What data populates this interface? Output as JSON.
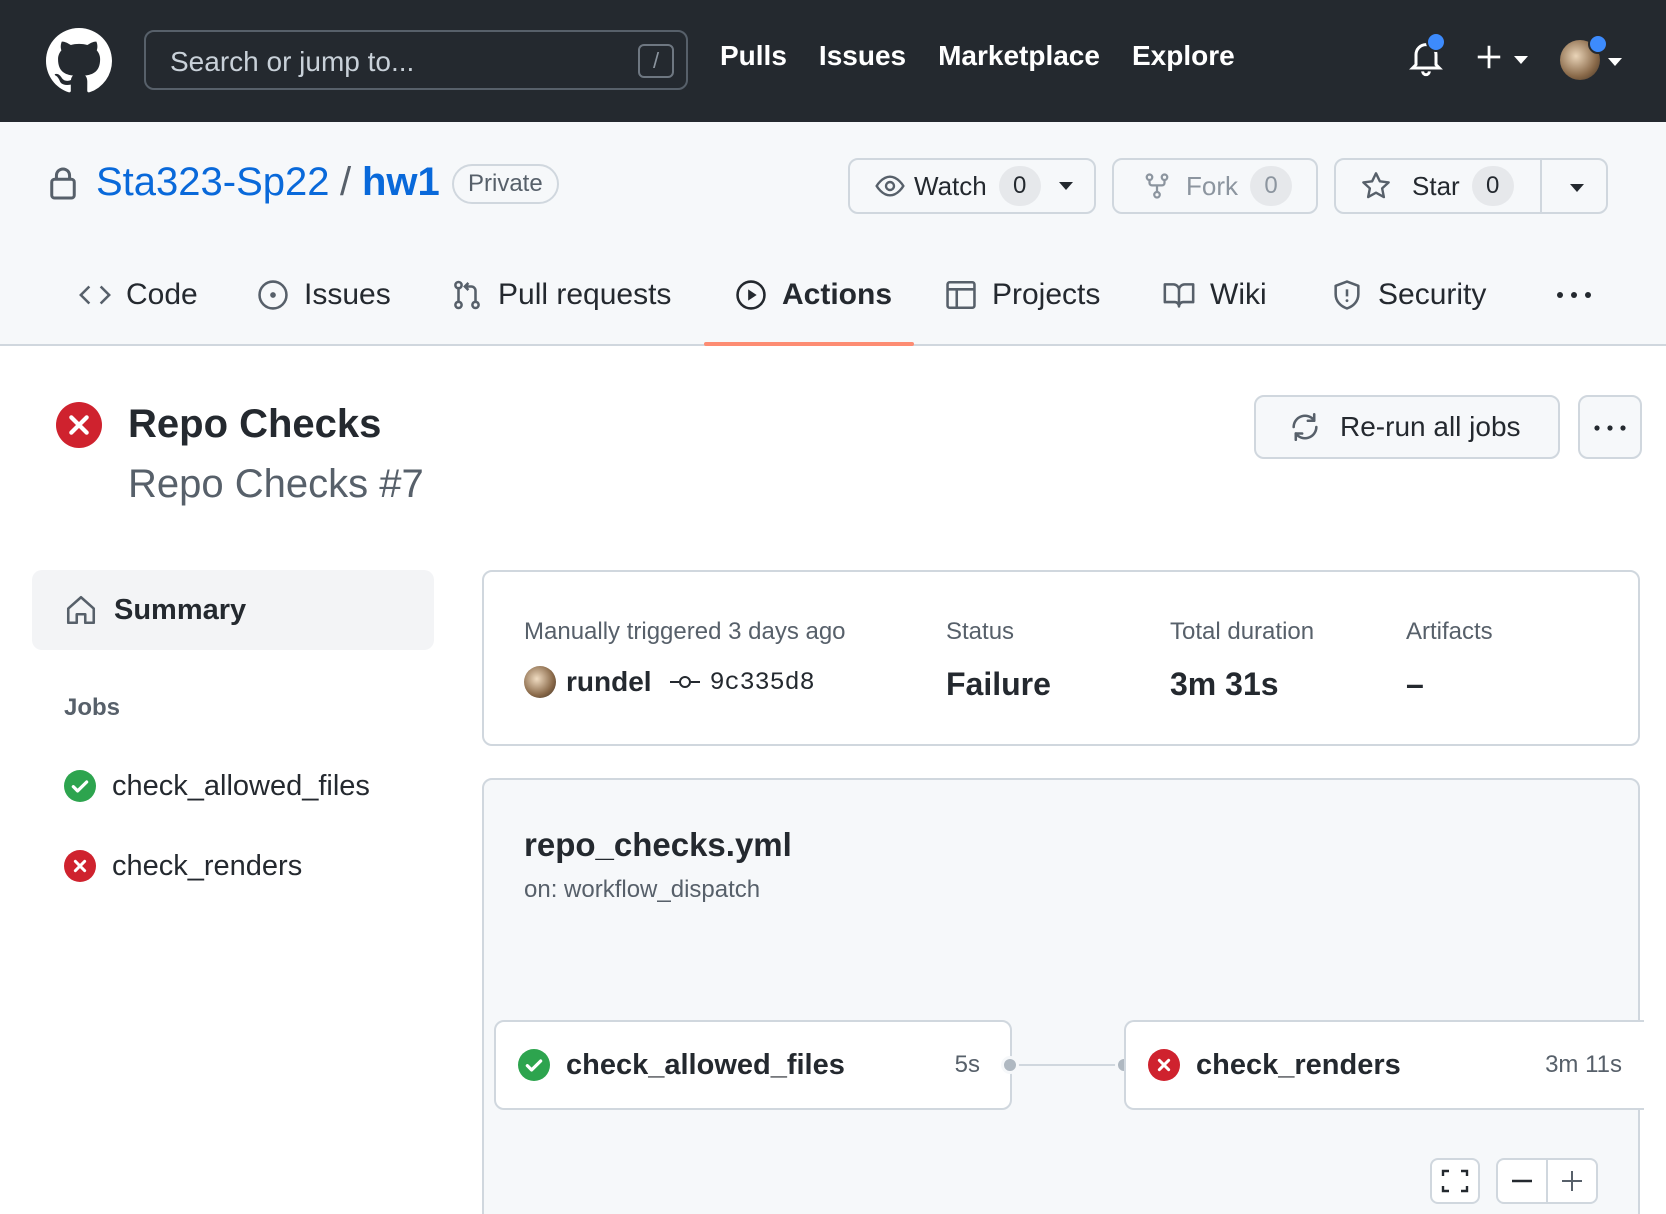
{
  "header": {
    "search_placeholder": "Search or jump to...",
    "search_shortcut": "/",
    "nav": [
      "Pulls",
      "Issues",
      "Marketplace",
      "Explore"
    ]
  },
  "repo": {
    "owner": "Sta323-Sp22",
    "separator": "/",
    "name": "hw1",
    "visibility": "Private",
    "watch": {
      "label": "Watch",
      "count": "0"
    },
    "fork": {
      "label": "Fork",
      "count": "0"
    },
    "star": {
      "label": "Star",
      "count": "0"
    }
  },
  "tabs": [
    {
      "label": "Code",
      "icon": "code-icon"
    },
    {
      "label": "Issues",
      "icon": "issue-opened-icon"
    },
    {
      "label": "Pull requests",
      "icon": "git-pull-request-icon"
    },
    {
      "label": "Actions",
      "icon": "play-icon",
      "active": true
    },
    {
      "label": "Projects",
      "icon": "table-icon"
    },
    {
      "label": "Wiki",
      "icon": "book-icon"
    },
    {
      "label": "Security",
      "icon": "shield-icon"
    }
  ],
  "run": {
    "title": "Repo Checks",
    "subtitle": "Repo Checks #7",
    "status": "failure",
    "rerun_label": "Re-run all jobs"
  },
  "sidebar": {
    "summary_label": "Summary",
    "jobs_heading": "Jobs",
    "jobs": [
      {
        "name": "check_allowed_files",
        "status": "success"
      },
      {
        "name": "check_renders",
        "status": "failure"
      }
    ]
  },
  "summary": {
    "trigger_label": "Manually triggered 3 days ago",
    "actor": "rundel",
    "commit": "9c335d8",
    "status_label": "Status",
    "status_value": "Failure",
    "duration_label": "Total duration",
    "duration_value": "3m 31s",
    "artifacts_label": "Artifacts",
    "artifacts_value": "–"
  },
  "workflow": {
    "file": "repo_checks.yml",
    "trigger": "on: workflow_dispatch",
    "nodes": [
      {
        "name": "check_allowed_files",
        "duration": "5s",
        "status": "success"
      },
      {
        "name": "check_renders",
        "duration": "3m 11s",
        "status": "failure"
      }
    ]
  },
  "colors": {
    "header_bg": "#24292f",
    "link": "#0969da",
    "success": "#2da44e",
    "failure": "#cf222e",
    "active_tab_underline": "#fd8c73",
    "notification_dot": "#3d8bfd"
  }
}
